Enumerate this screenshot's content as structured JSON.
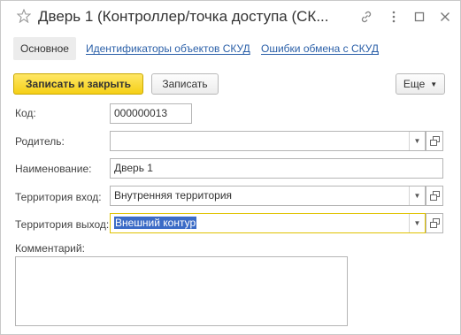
{
  "window": {
    "title": "Дверь 1 (Контроллер/точка доступа (СК..."
  },
  "tabs": [
    {
      "label": "Основное"
    },
    {
      "label": "Идентификаторы объектов СКУД"
    },
    {
      "label": "Ошибки обмена с СКУД"
    }
  ],
  "toolbar": {
    "save_close_label": "Записать и закрыть",
    "save_label": "Записать",
    "more_label": "Еще"
  },
  "form": {
    "code": {
      "label": "Код:",
      "value": "000000013"
    },
    "parent": {
      "label": "Родитель:",
      "value": ""
    },
    "name": {
      "label": "Наименование:",
      "value": "Дверь 1"
    },
    "territory_in": {
      "label": "Территория вход:",
      "value": "Внутренняя территория"
    },
    "territory_out": {
      "label": "Территория выход:",
      "value": "Внешний контур"
    },
    "comment": {
      "label": "Комментарий:",
      "value": ""
    }
  },
  "colors": {
    "primary_button": "#f5cf16",
    "link": "#2a5fa8",
    "selection": "#3b6bc6",
    "focus_border": "#e0c200"
  }
}
